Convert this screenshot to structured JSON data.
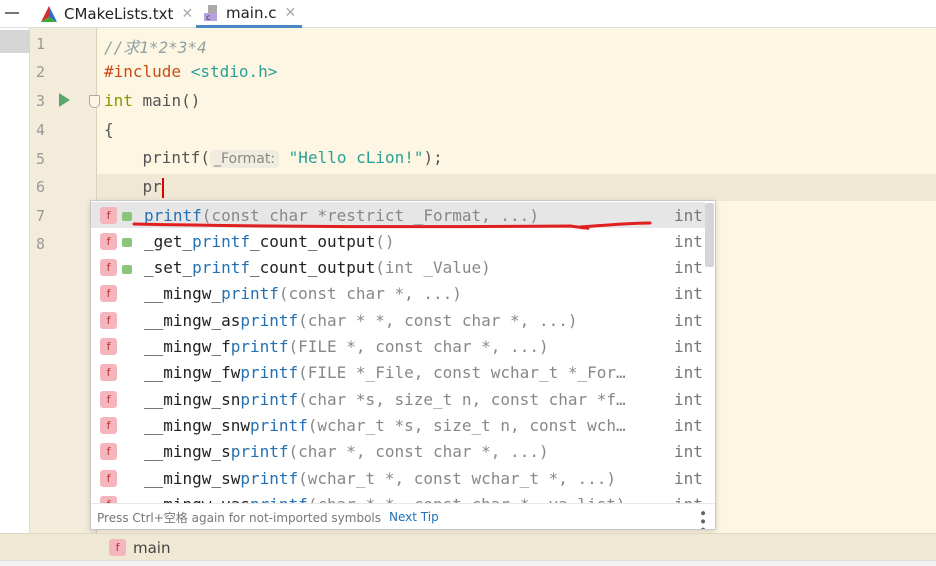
{
  "tabs": [
    {
      "label": "CMakeLists.txt",
      "icon": "cmake-icon"
    },
    {
      "label": "main.c",
      "icon": "c-file-icon",
      "active": true
    }
  ],
  "editor": {
    "line_numbers": [
      "1",
      "2",
      "3",
      "4",
      "5",
      "6",
      "7",
      "8"
    ],
    "lines": {
      "l1": "//求1*2*3*4",
      "l2_pp": "#include",
      "l2_str": "<stdio.h>",
      "l3_kw": "int",
      "l3_rest": " main()",
      "l4": "{",
      "l5_a": "    printf(",
      "l5_hint": "_Format:",
      "l5_str": "\"Hello cLion!\"",
      "l5_b": ");",
      "l6": "    pr"
    }
  },
  "completion": {
    "items": [
      {
        "pre": "",
        "match": "printf",
        "params": "(const char *restrict _Format, ...)",
        "type": "int",
        "locked": true,
        "selected": true
      },
      {
        "pre": "_get_",
        "match": "printf",
        "rest": "_count_output",
        "params": "()",
        "type": "int",
        "locked": true
      },
      {
        "pre": "_set_",
        "match": "printf",
        "rest": "_count_output",
        "params": "(int _Value)",
        "type": "int",
        "locked": true
      },
      {
        "pre": "__mingw_",
        "match": "printf",
        "params": "(const char *, ...)",
        "type": "int"
      },
      {
        "pre": "__mingw_as",
        "match": "printf",
        "params": "(char * *, const char *, ...)",
        "type": "int"
      },
      {
        "pre": "__mingw_f",
        "match": "printf",
        "params": "(FILE *, const char *, ...)",
        "type": "int"
      },
      {
        "pre": "__mingw_fw",
        "match": "printf",
        "params": "(FILE *_File, const wchar_t *_For…",
        "type": "int"
      },
      {
        "pre": "__mingw_sn",
        "match": "printf",
        "params": "(char *s, size_t n, const char *f…",
        "type": "int"
      },
      {
        "pre": "__mingw_snw",
        "match": "printf",
        "params": "(wchar_t *s, size_t n, const wch…",
        "type": "int"
      },
      {
        "pre": "__mingw_s",
        "match": "printf",
        "params": "(char *, const char *, ...)",
        "type": "int"
      },
      {
        "pre": "__mingw_sw",
        "match": "printf",
        "params": "(wchar_t *, const wchar_t *, ...)",
        "type": "int"
      },
      {
        "pre": "__mingw_vas",
        "match": "printf",
        "params": "(char * *, const char *, va_list)",
        "type": "int"
      }
    ],
    "footer_text": "Press Ctrl+空格 again for not-imported symbols",
    "footer_link": "Next Tip"
  },
  "breadcrumb": {
    "icon": "f",
    "label": "main"
  },
  "function_icon_letter": "f",
  "colors": {
    "annotation": "#e02020",
    "accent": "#4a88c7"
  }
}
